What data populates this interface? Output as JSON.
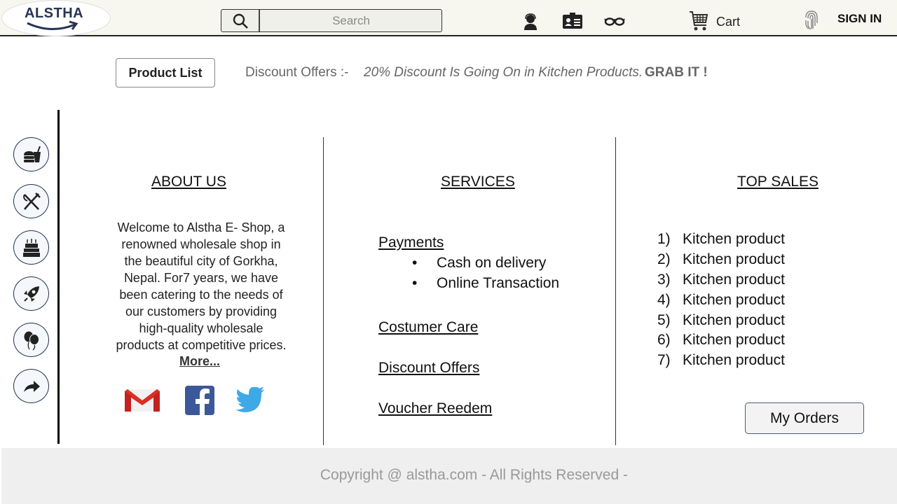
{
  "header": {
    "logo_text": "ALSTHA",
    "search_placeholder": "Search",
    "cart_label": "Cart",
    "signin_label": "SIGN IN",
    "icons": [
      "support-agent-icon",
      "contact-card-icon",
      "glasses-icon",
      "cart-icon",
      "fingerprint-icon"
    ]
  },
  "topbar": {
    "product_list_label": "Product List",
    "discount_label": "Discount Offers :-",
    "discount_text": "20% Discount Is Going On in Kitchen Products.",
    "grab_text": "GRAB IT !"
  },
  "sidebar": {
    "items": [
      "fast-food-icon",
      "fork-knife-icon",
      "cake-icon",
      "rocket-icon",
      "balloons-icon",
      "share-arrow-icon"
    ]
  },
  "about": {
    "heading": "ABOUT US",
    "lines": [
      "Welcome to Alstha E- Shop, a",
      "renowned wholesale shop in",
      "the beautiful city of Gorkha,",
      "Nepal. For7 years, we have",
      "been catering to the needs of",
      "our customers by providing",
      "high-quality wholesale",
      "products at competitive prices."
    ],
    "more_label": "More...",
    "social": [
      "gmail-icon",
      "facebook-icon",
      "twitter-icon"
    ]
  },
  "services": {
    "heading": "SERVICES",
    "payments_label": "Payments",
    "payment_options": [
      "Cash on delivery",
      "Online Transaction"
    ],
    "customer_care_label": "Costumer Care",
    "discount_offers_label": "Discount Offers",
    "voucher_label": "Voucher Reedem"
  },
  "top_sales": {
    "heading": "TOP SALES",
    "items": [
      {
        "num": "1)",
        "name": "Kitchen product"
      },
      {
        "num": "2)",
        "name": "Kitchen product"
      },
      {
        "num": "3)",
        "name": "Kitchen product"
      },
      {
        "num": "4)",
        "name": "Kitchen product"
      },
      {
        "num": "5)",
        "name": "Kitchen product"
      },
      {
        "num": "6)",
        "name": "Kitchen product"
      },
      {
        "num": "7)",
        "name": "Kitchen product"
      }
    ],
    "my_orders_label": "My Orders"
  },
  "footer": {
    "copyright": "Copyright @ alstha.com - All Rights Reserved -"
  },
  "colors": {
    "header_bg": "#f7f7f0",
    "brand_navy": "#263454",
    "footer_bg": "#efefef",
    "muted_text": "#999999"
  }
}
